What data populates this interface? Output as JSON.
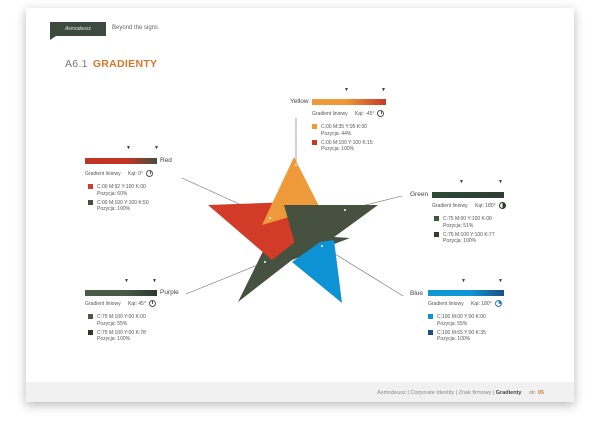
{
  "header": {
    "logo_text": "Asmodeusz",
    "tagline": "Beyond the signs"
  },
  "title": {
    "number": "A6.1",
    "name": "GRADIENTY"
  },
  "colors": {
    "yellow_start": "#ef9a3a",
    "yellow_end": "#c63a27",
    "red_start": "#c03426",
    "red_end": "#43503f",
    "green_start": "#2c4a36",
    "green_end": "#2f3c34",
    "blue_start": "#0f96d6",
    "blue_end": "#1b4f82",
    "purple_start": "#4a5a46",
    "purple_end": "#2c3a2d",
    "star_red": "#d23b27",
    "star_orange": "#ef9a3a",
    "star_green": "#46513f",
    "star_blue": "#0d92d3"
  },
  "gradients": {
    "yellow": {
      "label": "Yellow",
      "type_label": "Gradient liniowy",
      "angle": "Kąt: -45°",
      "stops": [
        {
          "cmyk": "C:00    M:35    Y:95    K:00",
          "pos": "Pozycja: 44%"
        },
        {
          "cmyk": "C:00    M:100    Y:100    K:15",
          "pos": "Pozycja: 100%"
        }
      ]
    },
    "red": {
      "label": "Red",
      "type_label": "Gradient liniowy",
      "angle": "Kąt: 0°",
      "stops": [
        {
          "cmyk": "C:00    M:92    Y:100    K:00",
          "pos": "Pozycja: 60%"
        },
        {
          "cmyk": "C:00    M:100    Y:100    K:50",
          "pos": "Pozycja: 100%"
        }
      ]
    },
    "green": {
      "label": "Green",
      "type_label": "Gradient liniowy",
      "angle": "Kąt: 180°",
      "stops": [
        {
          "cmyk": "C:75    M:00    Y:100    K:00",
          "pos": "Pozycja: 51%"
        },
        {
          "cmyk": "C:75    M:100    Y:100    K:77",
          "pos": "Pozycja: 100%"
        }
      ]
    },
    "blue": {
      "label": "Blue",
      "type_label": "Gradient liniowy",
      "angle": "Kąt: 180°",
      "stops": [
        {
          "cmyk": "C:100    M:00    Y:00    K:00",
          "pos": "Pozycja: 55%"
        },
        {
          "cmyk": "C:100    M:65    Y:00    K:35",
          "pos": "Pozycja: 100%"
        }
      ]
    },
    "purple": {
      "label": "Purple",
      "type_label": "Gradient liniowy",
      "angle": "Kąt: 45°",
      "stops": [
        {
          "cmyk": "C:75    M:100    Y:00    K:00",
          "pos": "Pozycja: 55%"
        },
        {
          "cmyk": "C:75    M:100    Y:00    K:78",
          "pos": "Pozycja: 100%"
        }
      ]
    }
  },
  "footer": {
    "breadcrumb": "Asmodeusz | Corporate Identity | Znak firmowy | ",
    "section": "Gradienty",
    "page_label": "str.",
    "page_num": "05"
  }
}
